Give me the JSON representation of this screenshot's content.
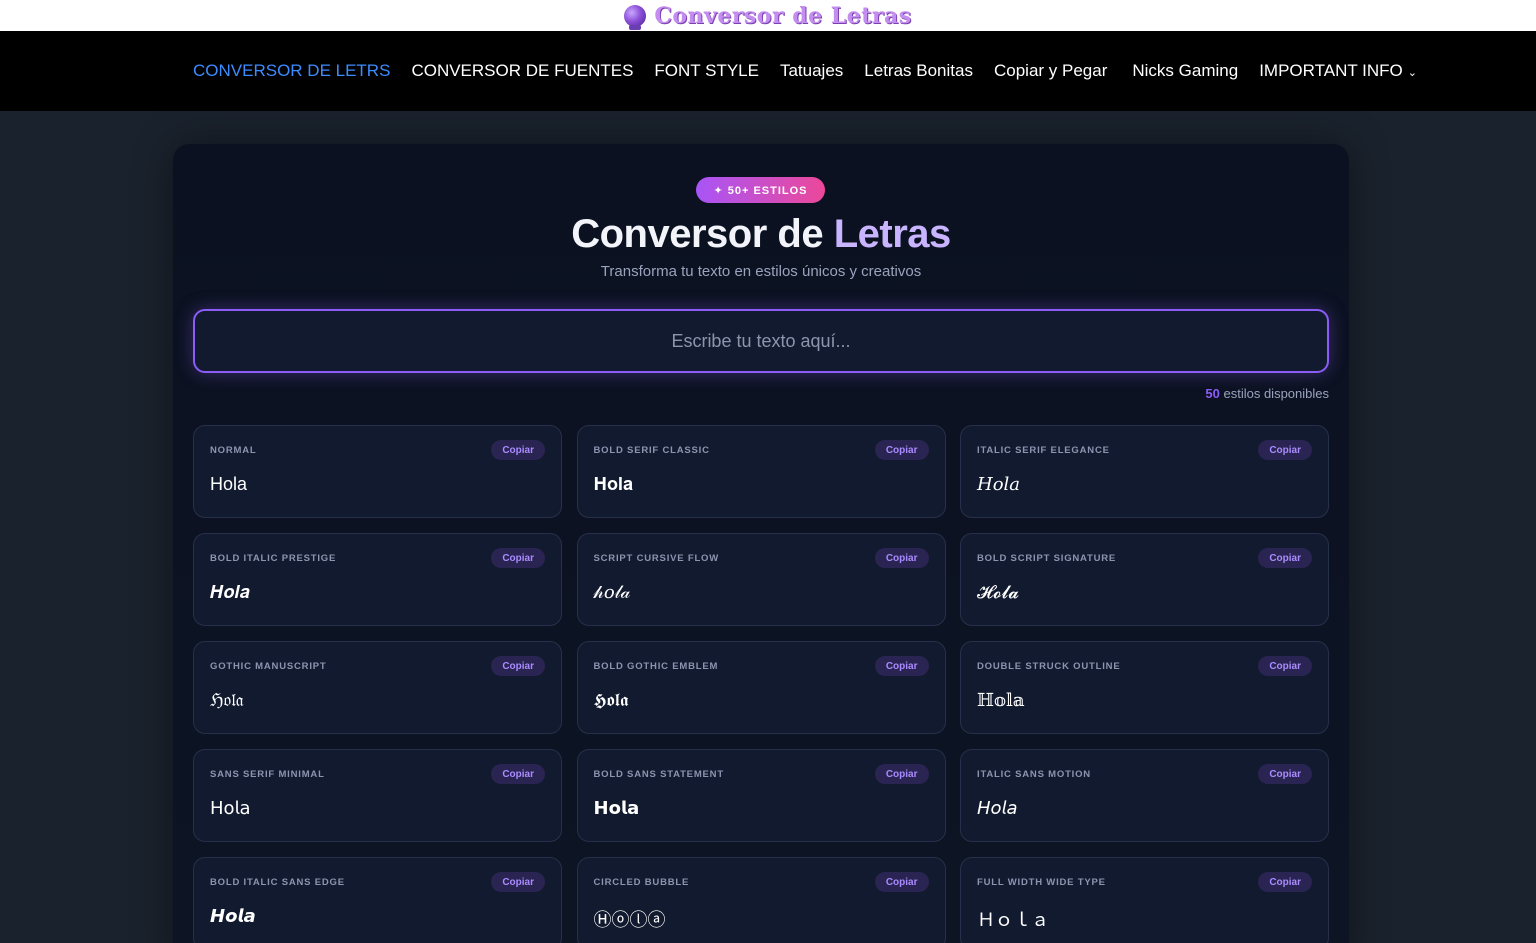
{
  "logo": {
    "text": "Conversor de Letras",
    "icon": "crystal-ball-icon"
  },
  "nav": {
    "items": [
      {
        "label": "CONVERSOR DE LETRS",
        "active": true
      },
      {
        "label": "CONVERSOR DE FUENTES"
      },
      {
        "label": "FONT STYLE"
      },
      {
        "label": "Tatuajes"
      },
      {
        "label": "Letras Bonitas"
      },
      {
        "label": "Copiar y Pegar"
      },
      {
        "label": "Nicks Gaming"
      },
      {
        "label": "IMPORTANT INFO",
        "dropdown": true
      }
    ]
  },
  "hero": {
    "badge": "✦ 50+ ESTILOS",
    "title_main": "Conversor de",
    "title_accent": "Letras",
    "subtitle": "Transforma tu texto en estilos únicos y creativos"
  },
  "input": {
    "placeholder": "Escribe tu texto aquí...",
    "value": ""
  },
  "count": {
    "number": "50",
    "label": "estilos disponibles"
  },
  "copy_label": "Copiar",
  "styles": [
    {
      "name": "NORMAL",
      "preview": "Hola",
      "font": "f-normal"
    },
    {
      "name": "BOLD SERIF CLASSIC",
      "preview": "𝐇𝐨𝐥𝐚",
      "font": "f-serif"
    },
    {
      "name": "ITALIC SERIF ELEGANCE",
      "preview": "𝐻𝑜𝑙𝑎",
      "font": "f-serif"
    },
    {
      "name": "BOLD ITALIC PRESTIGE",
      "preview": "𝑯𝒐𝒍𝒂",
      "font": "f-serif"
    },
    {
      "name": "SCRIPT CURSIVE FLOW",
      "preview": "𝒽𝑜𝓁𝒶",
      "font": "f-serif"
    },
    {
      "name": "BOLD SCRIPT SIGNATURE",
      "preview": "𝓗𝓸𝓵𝓪",
      "font": "f-serif"
    },
    {
      "name": "GOTHIC MANUSCRIPT",
      "preview": "ℌ𝔬𝔩𝔞",
      "font": "f-serif"
    },
    {
      "name": "BOLD GOTHIC EMBLEM",
      "preview": "𝕳𝖔𝖑𝖆",
      "font": "f-serif"
    },
    {
      "name": "DOUBLE STRUCK OUTLINE",
      "preview": "ℍ𝕠𝕝𝕒",
      "font": "f-serif"
    },
    {
      "name": "SANS SERIF MINIMAL",
      "preview": "𝖧𝗈𝗅𝖺",
      "font": "f-sans"
    },
    {
      "name": "BOLD SANS STATEMENT",
      "preview": "𝗛𝗼𝗹𝗮",
      "font": "f-sans"
    },
    {
      "name": "ITALIC SANS MOTION",
      "preview": "𝘏𝘰𝘭𝘢",
      "font": "f-sans"
    },
    {
      "name": "BOLD ITALIC SANS EDGE",
      "preview": "𝙃𝙤𝙡𝙖",
      "font": "f-sans"
    },
    {
      "name": "CIRCLED BUBBLE",
      "preview": "Ⓗⓞⓛⓐ",
      "font": "f-sans"
    },
    {
      "name": "FULL WIDTH WIDE TYPE",
      "preview": "Ｈｏｌａ",
      "font": "f-sans"
    }
  ],
  "colors": {
    "accent": "#8b5cf6",
    "nav_active": "#3d8bff",
    "badge_from": "#a855f7",
    "badge_to": "#ec4899"
  }
}
